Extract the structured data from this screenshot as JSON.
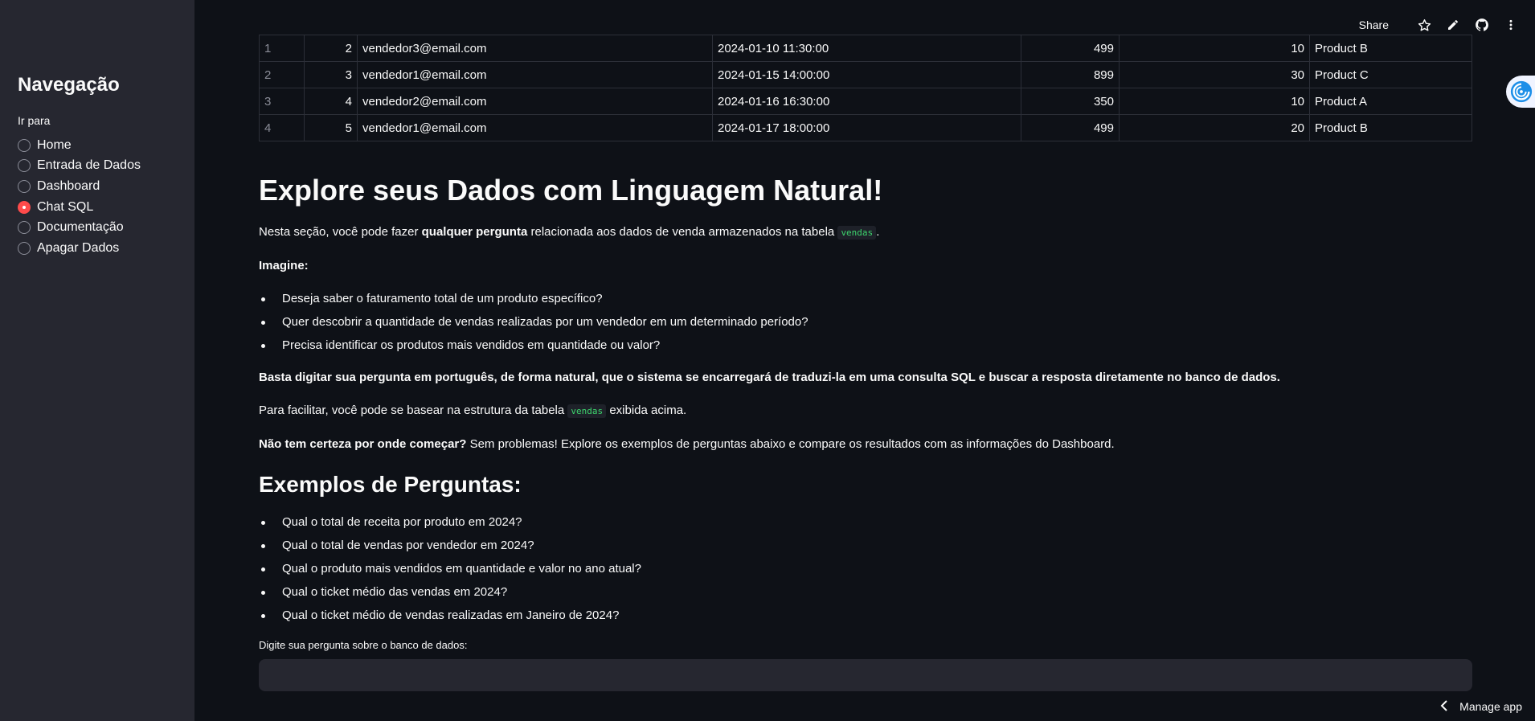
{
  "sidebar": {
    "title": "Navegação",
    "radio_label": "Ir para",
    "items": [
      {
        "label": "Home",
        "selected": false
      },
      {
        "label": "Entrada de Dados",
        "selected": false
      },
      {
        "label": "Dashboard",
        "selected": false
      },
      {
        "label": "Chat SQL",
        "selected": true
      },
      {
        "label": "Documentação",
        "selected": false
      },
      {
        "label": "Apagar Dados",
        "selected": false
      }
    ]
  },
  "header": {
    "share_label": "Share",
    "icons": [
      "star-icon",
      "edit-pencil-icon",
      "github-icon",
      "more-vertical-icon"
    ]
  },
  "table": {
    "rows": [
      {
        "index": "1",
        "id": "2",
        "email": "vendedor3@email.com",
        "date": "2024-01-10 11:30:00",
        "price": "499",
        "qty": "10",
        "product": "Product B"
      },
      {
        "index": "2",
        "id": "3",
        "email": "vendedor1@email.com",
        "date": "2024-01-15 14:00:00",
        "price": "899",
        "qty": "30",
        "product": "Product C"
      },
      {
        "index": "3",
        "id": "4",
        "email": "vendedor2@email.com",
        "date": "2024-01-16 16:30:00",
        "price": "350",
        "qty": "10",
        "product": "Product A"
      },
      {
        "index": "4",
        "id": "5",
        "email": "vendedor1@email.com",
        "date": "2024-01-17 18:00:00",
        "price": "499",
        "qty": "20",
        "product": "Product B"
      }
    ]
  },
  "content": {
    "title": "Explore seus Dados com Linguagem Natural!",
    "intro_prefix": "Nesta seção, você pode fazer ",
    "intro_bold": "qualquer pergunta",
    "intro_suffix": " relacionada aos dados de venda armazenados na tabela ",
    "table_name": "vendas",
    "intro_end": ".",
    "imagine": "Imagine:",
    "imagine_items": [
      "Deseja saber o faturamento total de um produto específico?",
      "Quer descobrir a quantidade de vendas realizadas por um vendedor em um determinado período?",
      "Precisa identificar os produtos mais vendidos em quantidade ou valor?"
    ],
    "basta": "Basta digitar sua pergunta em português, de forma natural, que o sistema se encarregará de traduzi-la em uma consulta SQL e buscar a resposta diretamente no banco de dados.",
    "facilitar_prefix": "Para facilitar, você pode se basear na estrutura da tabela ",
    "facilitar_suffix": " exibida acima.",
    "nao_tem_bold": "Não tem certeza por onde começar?",
    "nao_tem_rest": " Sem problemas! Explore os exemplos de perguntas abaixo e compare os resultados com as informações do Dashboard.",
    "examples_title": "Exemplos de Perguntas:",
    "examples": [
      "Qual o total de receita por produto em 2024?",
      "Qual o total de vendas por vendedor em 2024?",
      "Qual o produto mais vendidos em quantidade e valor no ano atual?",
      "Qual o ticket médio das vendas em 2024?",
      "Qual o ticket médio de vendas realizadas em Janeiro de 2024?"
    ],
    "input_label": "Digite sua pergunta sobre o banco de dados:",
    "input_value": ""
  },
  "footer": {
    "manage_app": "Manage app"
  },
  "colors": {
    "background": "#0e1117",
    "sidebar": "#262730",
    "accent": "#ff4b4b",
    "code_text": "#3dd56d"
  }
}
